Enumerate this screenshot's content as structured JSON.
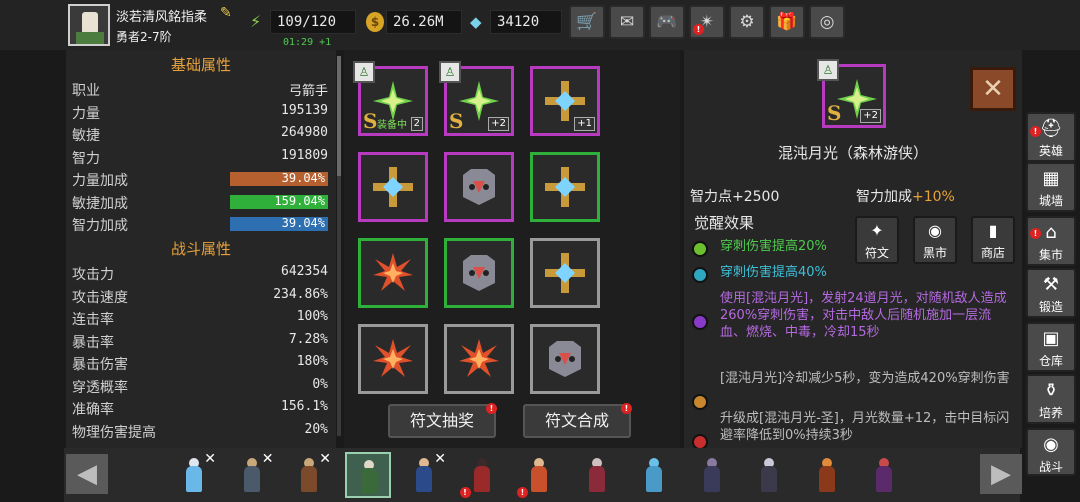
{
  "player": {
    "name": "淡若清风銘指柔",
    "rank": "勇者2-7阶",
    "energy": "109/120",
    "energy_timer": "01:29 +1",
    "gold": "26.26M",
    "gems": "34120"
  },
  "toolbar": [
    {
      "name": "shop-cart",
      "icon": "🛒"
    },
    {
      "name": "mail",
      "icon": "✉"
    },
    {
      "name": "gamepad",
      "icon": "🎮"
    },
    {
      "name": "effects",
      "icon": "✴"
    },
    {
      "name": "settings",
      "icon": "⚙"
    },
    {
      "name": "gift",
      "icon": "🎁"
    },
    {
      "name": "color-wheel",
      "icon": "◎"
    }
  ],
  "stats": {
    "basic_header": "基础属性",
    "combat_header": "战斗属性",
    "basic": [
      {
        "label": "职业",
        "value": "弓箭手"
      },
      {
        "label": "力量",
        "value": "195139"
      },
      {
        "label": "敏捷",
        "value": "264980"
      },
      {
        "label": "智力",
        "value": "191809"
      }
    ],
    "bonuses": [
      {
        "label": "力量加成",
        "value": "39.04%",
        "color": "#b5602e"
      },
      {
        "label": "敏捷加成",
        "value": "159.04%",
        "color": "#2fb03a"
      },
      {
        "label": "智力加成",
        "value": "39.04%",
        "color": "#2d6fb0"
      }
    ],
    "combat": [
      {
        "label": "攻击力",
        "value": "642354"
      },
      {
        "label": "攻击速度",
        "value": "234.86%"
      },
      {
        "label": "连击率",
        "value": "100%"
      },
      {
        "label": "暴击率",
        "value": "7.28%"
      },
      {
        "label": "暴击伤害",
        "value": "180%"
      },
      {
        "label": "穿透概率",
        "value": "0%"
      },
      {
        "label": "准确率",
        "value": "156.1%"
      },
      {
        "label": "物理伤害提高",
        "value": "20%"
      }
    ]
  },
  "runes": {
    "equipped_label": "装备中",
    "level_labels": [
      "2",
      "+2",
      "+1"
    ],
    "grade": "S",
    "draw_button": "符文抽奖",
    "merge_button": "符文合成"
  },
  "detail": {
    "grade": "S",
    "level": "+2",
    "name": "混沌月光（森林游侠）",
    "attr_int_points": "智力点+2500",
    "attr_int_bonus_label": "智力加成",
    "attr_int_bonus_value": "+10%",
    "awaken_header": "觉醒效果",
    "effects": [
      {
        "color": "#6cc02e",
        "text_color": "#4ecb4e",
        "text": "穿刺伤害提高20%"
      },
      {
        "color": "#2ea8c0",
        "text_color": "#3ec0d8",
        "text": "穿刺伤害提高40%"
      },
      {
        "color": "#8a3ac8",
        "text_color": "#b56ae0",
        "text": "使用[混沌月光]，发射24道月光，对随机敌人造成260%穿刺伤害，对击中敌人后随机施加一层流血、燃烧、中毒，冷却15秒"
      },
      {
        "color": "#c8862e",
        "text_color": "#bdbdbd",
        "text": "[混沌月光]冷却减少5秒，变为造成420%穿刺伤害"
      },
      {
        "color": "#c82e2e",
        "text_color": "#bdbdbd",
        "text": "升级成[混沌月光-圣]，月光数量+12，击中目标闪避率降低到0%持续3秒"
      }
    ],
    "quick": [
      {
        "label": "符文",
        "icon": "✦"
      },
      {
        "label": "黑市",
        "icon": "◉"
      },
      {
        "label": "商店",
        "icon": "▮"
      }
    ]
  },
  "side_nav": [
    {
      "label": "英雄",
      "icon": "⛑"
    },
    {
      "label": "城墙",
      "icon": "▦"
    },
    {
      "label": "集市",
      "icon": "⌂"
    },
    {
      "label": "锻造",
      "icon": "⚒"
    },
    {
      "label": "仓库",
      "icon": "▣"
    },
    {
      "label": "培养",
      "icon": "⚱"
    },
    {
      "label": "战斗",
      "icon": "◉"
    }
  ]
}
